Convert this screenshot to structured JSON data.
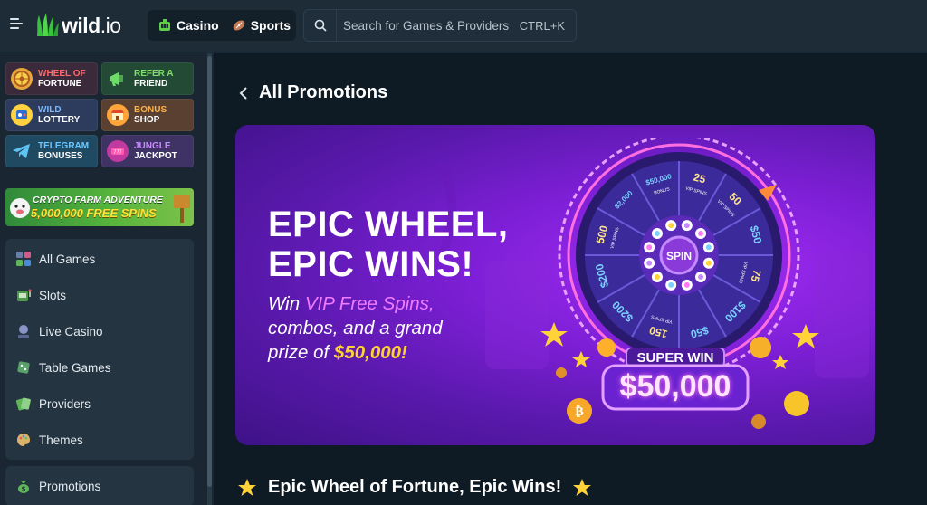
{
  "header": {
    "logo_text": "wild",
    "logo_suffix": ".io",
    "tabs": [
      {
        "label": "Casino",
        "icon": "casino-icon",
        "active": true
      },
      {
        "label": "Sports",
        "icon": "football-icon",
        "active": false
      }
    ],
    "search": {
      "placeholder": "Search for Games & Providers",
      "shortcut": "CTRL+K"
    }
  },
  "sidebar": {
    "promos": [
      {
        "line1": "Wheel of",
        "line2": "Fortune",
        "color1": "#f0c23b"
      },
      {
        "line1": "Refer a",
        "line2": "Friend",
        "color1": "#7de06a"
      },
      {
        "line1": "Wild",
        "line2": "Lottery",
        "color1": "#7ab8ff"
      },
      {
        "line1": "Bonus",
        "line2": "Shop",
        "color1": "#ffb14a"
      },
      {
        "line1": "Telegram",
        "line2": "Bonuses",
        "color1": "#6cc6ff"
      },
      {
        "line1": "Jungle",
        "line2": "Jackpot",
        "color1": "#c98bff"
      }
    ],
    "crypto_banner": {
      "line1": "CRYPTO FARM ADVENTURE",
      "line2": "5,000,000 FREE SPINS"
    },
    "nav": [
      {
        "label": "All Games",
        "icon": "grid-icon"
      },
      {
        "label": "Slots",
        "icon": "slot-machine-icon"
      },
      {
        "label": "Live Casino",
        "icon": "dealer-icon"
      },
      {
        "label": "Table Games",
        "icon": "dice-icon"
      },
      {
        "label": "Providers",
        "icon": "cards-icon"
      },
      {
        "label": "Themes",
        "icon": "palette-icon"
      }
    ],
    "nav2": [
      {
        "label": "Promotions",
        "icon": "money-bag-icon"
      }
    ]
  },
  "main": {
    "page_title": "All Promotions",
    "hero": {
      "title_line1": "EPIC WHEEL,",
      "title_line2": "EPIC WINS!",
      "sub_pre": "Win ",
      "sub_highlight": "VIP Free Spins,",
      "sub_line2": "combos, and a grand",
      "sub_line3_pre": "prize of ",
      "sub_prize": "$50,000!",
      "wheel_center": "SPIN",
      "wheel_segments": [
        "25",
        "50",
        "$50",
        "75",
        "$100",
        "$50",
        "150",
        "$200",
        "$200",
        "500",
        "$2,000",
        "$50,000"
      ],
      "wheel_segment_sublabels": [
        "VIP SPINS",
        "VIP SPINS",
        "",
        "VIP SPINS",
        "",
        "",
        "VIP SPINS",
        "",
        "",
        "VIP SPINS",
        "",
        "BONUS"
      ],
      "badge_top": "SUPER WIN",
      "badge_amount": "$50,000"
    },
    "section_title": "Epic Wheel of Fortune, Epic Wins!"
  },
  "colors": {
    "accent_green": "#3fbf3f",
    "hero_purple": "#7d1fd6",
    "gold": "#ffd233"
  }
}
